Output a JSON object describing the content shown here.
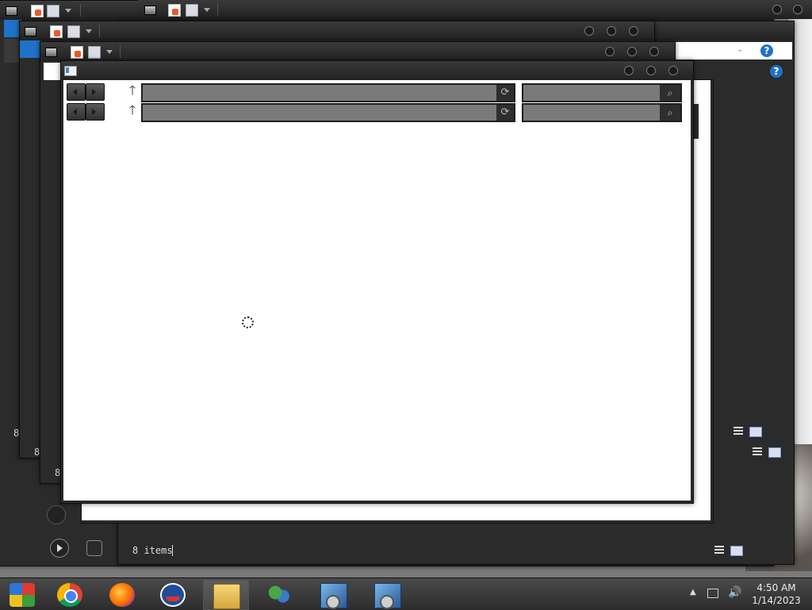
{
  "desktop": {},
  "windows": {
    "front": {
      "icon": "explorer-window-icon"
    },
    "back_status": {
      "items_text": "8 items"
    },
    "partial_status_1": {
      "items_text": "8"
    },
    "partial_status_2": {
      "items_text": "8"
    },
    "partial_status_3": {
      "items_text": "8"
    }
  },
  "navigation": {
    "up_glyph": "🡑",
    "refresh_glyph": "⟳",
    "search_glyph": "⌕"
  },
  "help": {
    "glyph": "?"
  },
  "taskbar": {
    "items": [
      {
        "name": "start-button",
        "icon": "windows-logo-icon"
      },
      {
        "name": "chrome",
        "icon": "chrome-icon"
      },
      {
        "name": "firefox",
        "icon": "firefox-icon"
      },
      {
        "name": "campaign-app",
        "icon": "obama-logo-icon"
      },
      {
        "name": "file-explorer",
        "icon": "folder-explorer-icon",
        "active": true
      },
      {
        "name": "messenger",
        "icon": "messenger-icon"
      },
      {
        "name": "setup-1",
        "icon": "installer-icon"
      },
      {
        "name": "setup-2",
        "icon": "installer-icon"
      }
    ]
  },
  "tray": {
    "arrow": "▲",
    "volume": "🔊"
  },
  "clock": {
    "time": "4:50 AM",
    "date": "1/14/2023"
  },
  "colors": {
    "accent": "#1e73c8",
    "window_frame": "#2b2b2b",
    "taskbar": "#333333"
  }
}
